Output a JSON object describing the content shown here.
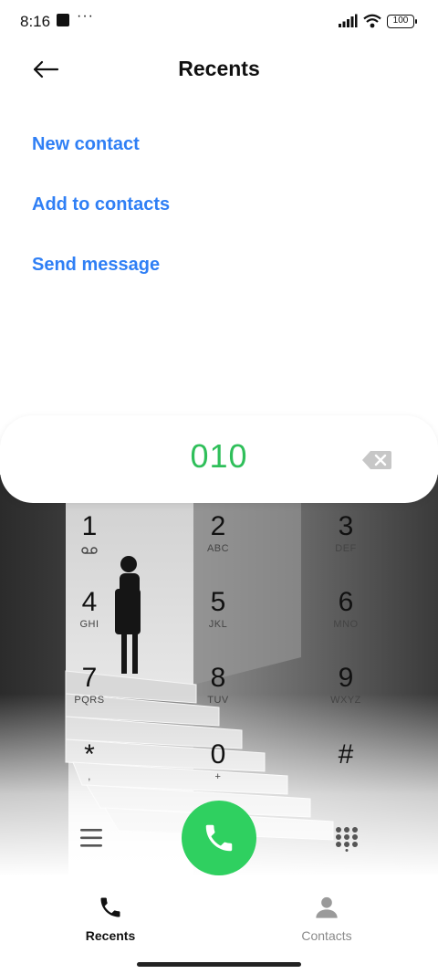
{
  "status_bar": {
    "time": "8:16",
    "more": "···",
    "battery": "100"
  },
  "header": {
    "title": "Recents"
  },
  "actions": [
    {
      "label": "New contact"
    },
    {
      "label": "Add to contacts"
    },
    {
      "label": "Send message"
    }
  ],
  "dialer": {
    "number": "010",
    "keys": [
      {
        "digit": "1",
        "letters": ""
      },
      {
        "digit": "2",
        "letters": "ABC"
      },
      {
        "digit": "3",
        "letters": "DEF"
      },
      {
        "digit": "4",
        "letters": "GHI"
      },
      {
        "digit": "5",
        "letters": "JKL"
      },
      {
        "digit": "6",
        "letters": "MNO"
      },
      {
        "digit": "7",
        "letters": "PQRS"
      },
      {
        "digit": "8",
        "letters": "TUV"
      },
      {
        "digit": "9",
        "letters": "WXYZ"
      },
      {
        "digit": "*",
        "letters": ","
      },
      {
        "digit": "0",
        "letters": "+"
      },
      {
        "digit": "#",
        "letters": ""
      }
    ]
  },
  "nav": {
    "recents": "Recents",
    "contacts": "Contacts"
  },
  "colors": {
    "accent": "#2f7ff5",
    "number": "#2fbf5a",
    "call": "#2fd060"
  }
}
